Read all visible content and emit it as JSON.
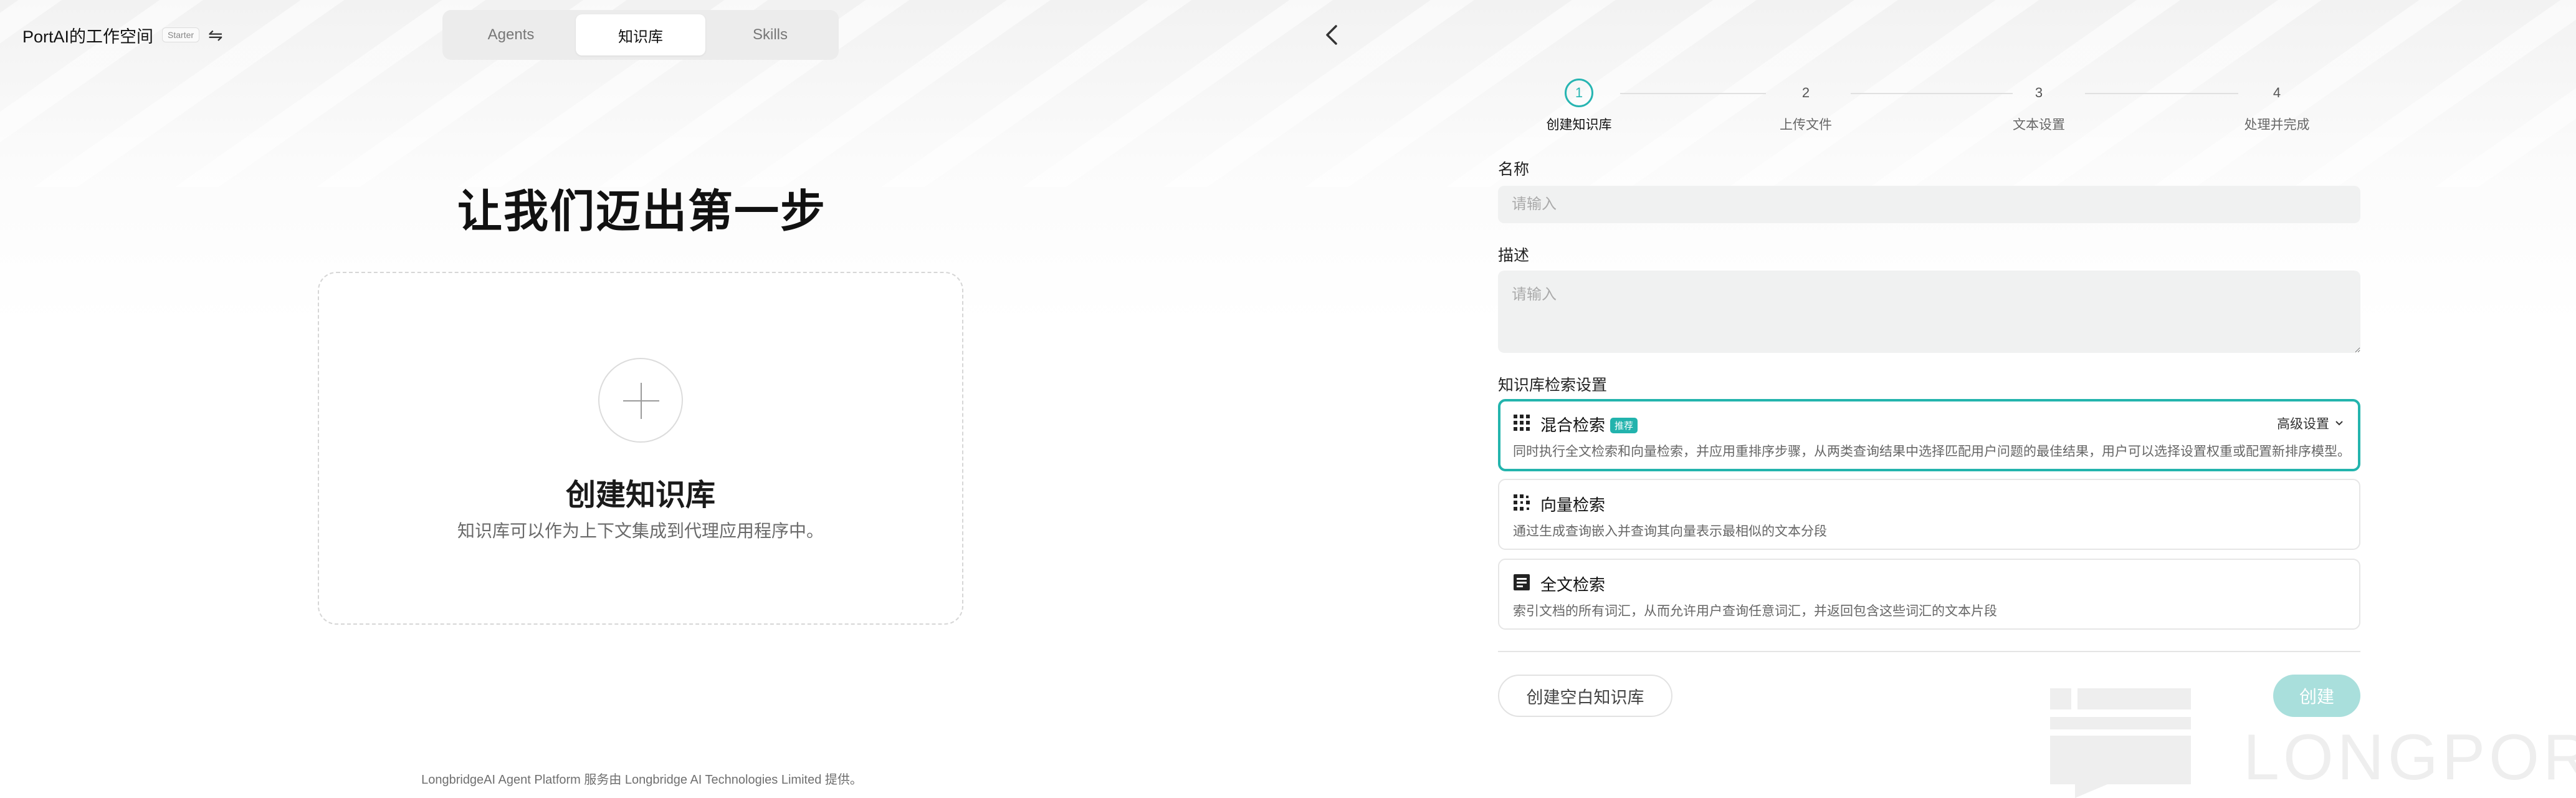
{
  "app": {
    "brand_title": "PortAI的工作空间",
    "plan_badge": "Starter",
    "switch_icon": "switch-arrows-icon"
  },
  "nav_tabs": [
    {
      "label": "Agents",
      "active": false
    },
    {
      "label": "知识库",
      "active": true
    },
    {
      "label": "Skills",
      "active": false
    }
  ],
  "left": {
    "hero_title": "让我们迈出第一步",
    "card_title": "创建知识库",
    "card_desc": "知识库可以作为上下文集成到代理应用程序中。",
    "footer": "LongbridgeAI Agent Platform 服务由 Longbridge AI Technologies Limited 提供。"
  },
  "steps": [
    {
      "num": "1",
      "label": "创建知识库",
      "active": true
    },
    {
      "num": "2",
      "label": "上传文件",
      "active": false
    },
    {
      "num": "3",
      "label": "文本设置",
      "active": false
    },
    {
      "num": "4",
      "label": "处理并完成",
      "active": false
    }
  ],
  "form": {
    "name_label": "名称",
    "name_placeholder": "请输入",
    "name_value": "",
    "desc_label": "描述",
    "desc_placeholder": "请输入",
    "desc_value": "",
    "retrieval_label": "知识库检索设置",
    "options": [
      {
        "title": "混合检索",
        "badge": "推荐",
        "desc": "同时执行全文检索和向量检索，并应用重排序步骤，从两类查询结果中选择匹配用户问题的最佳结果，用户可以选择设置权重或配置新排序模型。",
        "selected": true,
        "icon": "grid-dots-icon"
      },
      {
        "title": "向量检索",
        "badge": "",
        "desc": "通过生成查询嵌入并查询其向量表示最相似的文本分段",
        "selected": false,
        "icon": "vector-dots-icon"
      },
      {
        "title": "全文检索",
        "badge": "",
        "desc": "索引文档的所有词汇，从而允许用户查询任意词汇，并返回包含这些词汇的文本片段",
        "selected": false,
        "icon": "document-text-icon"
      }
    ],
    "advanced_label": "高级设置",
    "empty_button": "创建空白知识库",
    "create_button": "创建"
  },
  "colors": {
    "accent": "#23b4ad",
    "create_button_disabled": "#a9dfdc"
  },
  "watermark": "LONGPORT"
}
